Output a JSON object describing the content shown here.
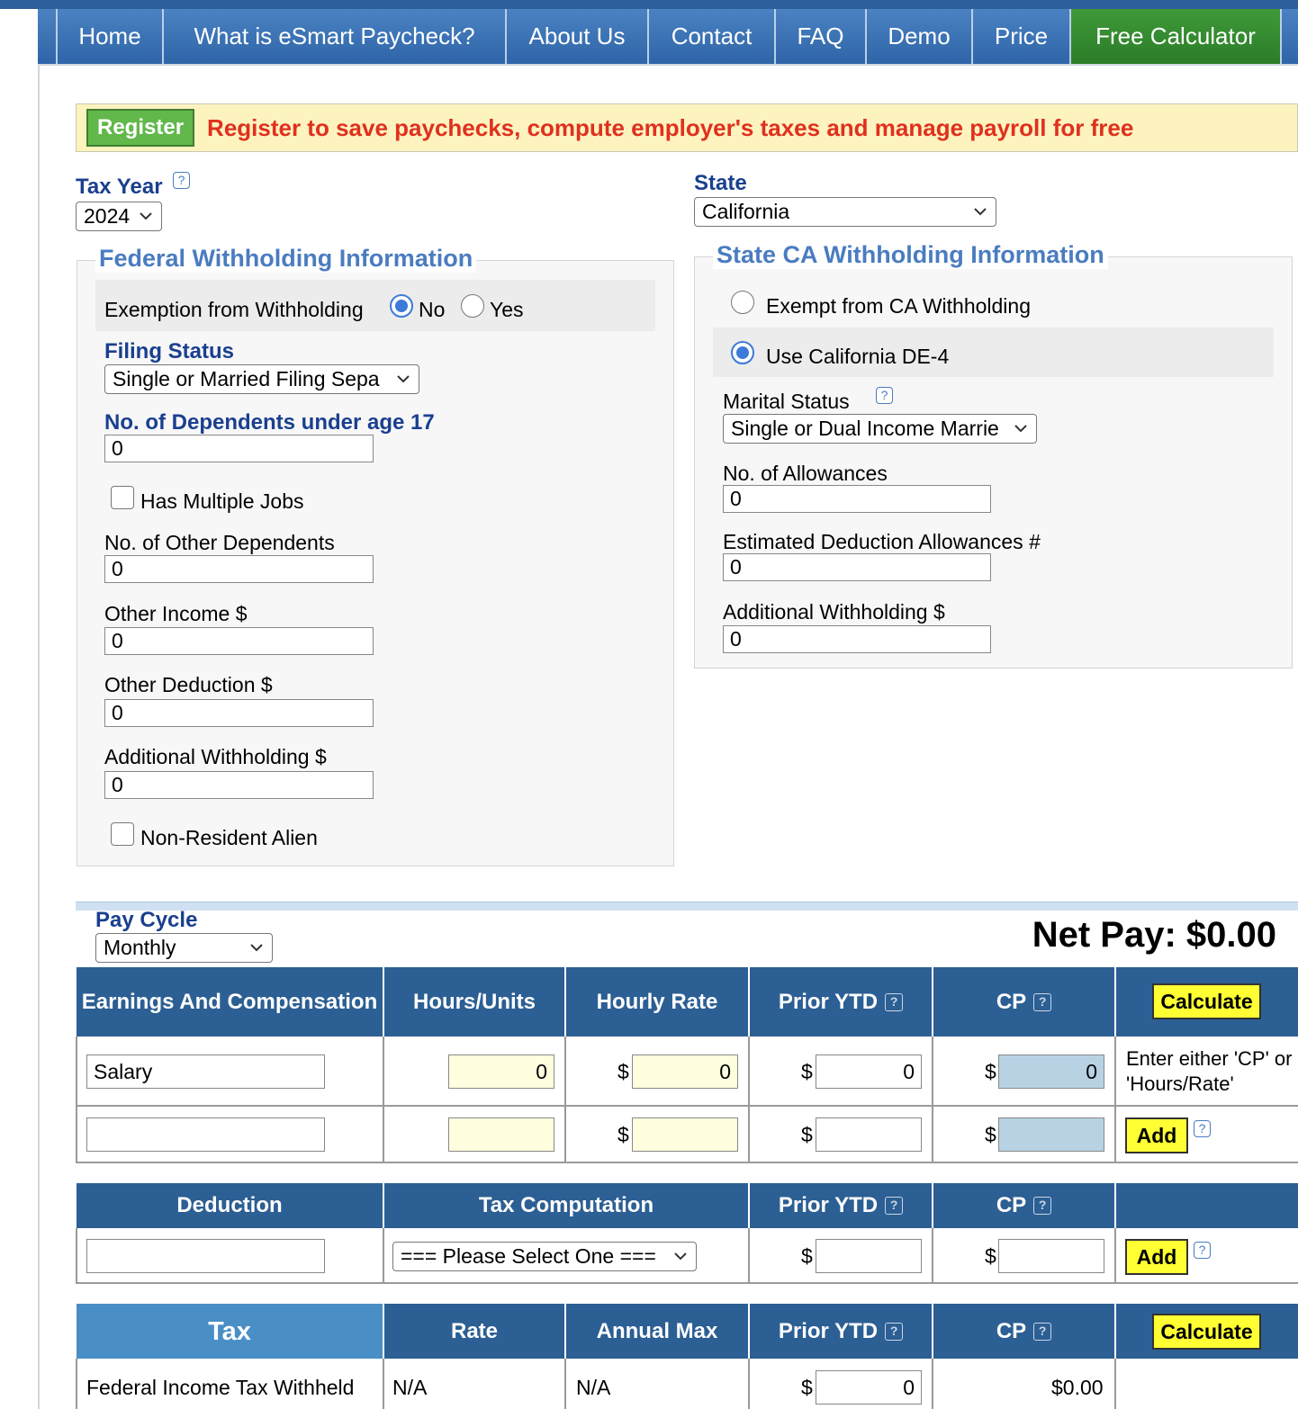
{
  "nav": {
    "items": [
      {
        "label": "Home",
        "width": 0
      },
      {
        "label": "What is eSmart Paycheck?"
      },
      {
        "label": "About Us"
      },
      {
        "label": "Contact"
      },
      {
        "label": "FAQ"
      },
      {
        "label": "Demo"
      },
      {
        "label": "Price"
      },
      {
        "label": "Free Calculator"
      }
    ]
  },
  "banner": {
    "register_label": "Register",
    "text": "Register to save paychecks, compute employer's taxes and manage payroll for free"
  },
  "tax_year": {
    "label": "Tax Year",
    "value": "2024"
  },
  "state": {
    "label": "State",
    "value": "California"
  },
  "federal": {
    "legend": "Federal Withholding Information",
    "exemption_label": "Exemption from Withholding",
    "no_label": "No",
    "yes_label": "Yes",
    "filing_status_label": "Filing Status",
    "filing_status_value": "Single or Married Filing Sepa",
    "dependents_label": "No. of Dependents under age 17",
    "dependents_value": "0",
    "multiple_jobs_label": "Has Multiple Jobs",
    "other_dependents_label": "No. of Other Dependents",
    "other_dependents_value": "0",
    "other_income_label": "Other Income $",
    "other_income_value": "0",
    "other_deduction_label": "Other Deduction $",
    "other_deduction_value": "0",
    "additional_withholding_label": "Additional Withholding $",
    "additional_withholding_value": "0",
    "nonresident_label": "Non-Resident Alien"
  },
  "state_wh": {
    "legend": "State CA Withholding Information",
    "exempt_label": "Exempt from CA Withholding",
    "use_de4_label": "Use California DE-4",
    "marital_label": "Marital Status",
    "marital_value": "Single or Dual Income Marrie",
    "allowances_label": "No. of Allowances",
    "allowances_value": "0",
    "est_deduction_label": "Estimated Deduction Allowances #",
    "est_deduction_value": "0",
    "additional_label": "Additional Withholding $",
    "additional_value": "0"
  },
  "pay_cycle": {
    "label": "Pay Cycle",
    "value": "Monthly"
  },
  "net_pay": "Net Pay: $0.00",
  "earnings": {
    "headers": [
      "Earnings And Compensation",
      "Hours/Units",
      "Hourly Rate",
      "Prior YTD",
      "CP"
    ],
    "calculate_label": "Calculate",
    "row1": {
      "name": "Salary",
      "hours": "0",
      "rate": "0",
      "prior": "0",
      "cp": "0",
      "hint": "Enter either 'CP' or 'Hours/Rate'"
    },
    "add_label": "Add",
    "dollar": "$"
  },
  "deduction": {
    "headers": [
      "Deduction",
      "Tax Computation",
      "Prior YTD",
      "CP"
    ],
    "select_value": "=== Please Select One ===",
    "add_label": "Add"
  },
  "tax": {
    "headers": [
      "Tax",
      "Rate",
      "Annual Max",
      "Prior YTD",
      "CP"
    ],
    "calculate_label": "Calculate",
    "row1": {
      "name": "Federal Income Tax Withheld",
      "rate": "N/A",
      "annual_max": "N/A",
      "prior": "0",
      "cp": "$0.00"
    }
  },
  "help_glyph": "?"
}
